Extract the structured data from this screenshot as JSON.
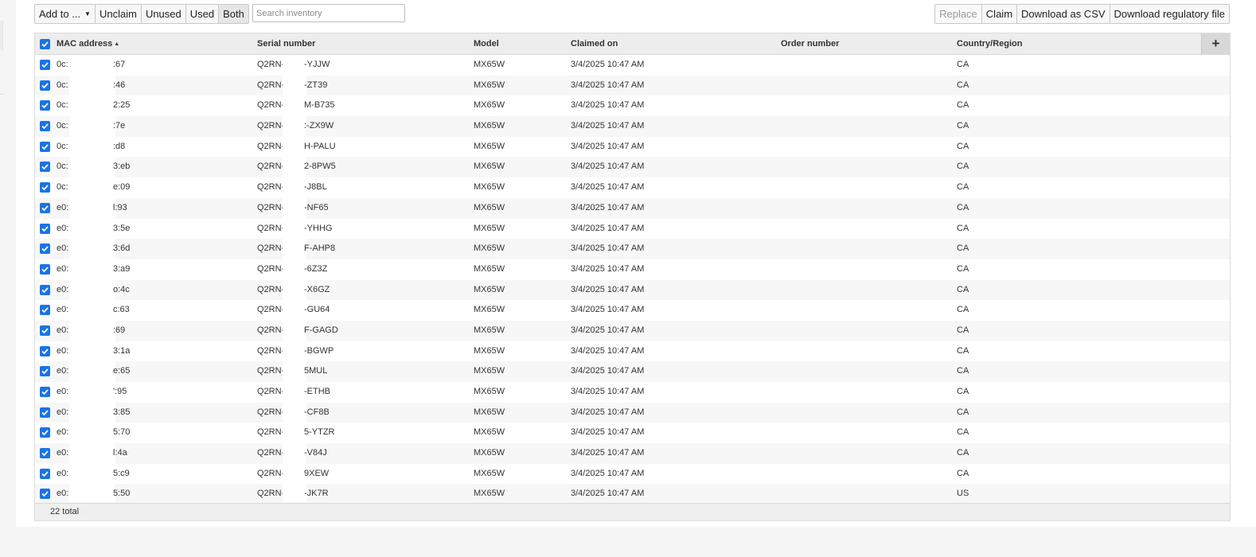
{
  "toolbar": {
    "add_to_label": "Add to ...",
    "filters": [
      "Unclaim",
      "Unused",
      "Used",
      "Both"
    ],
    "active_filter": "Both",
    "search_placeholder": "Search inventory",
    "replace_label": "Replace",
    "claim_label": "Claim",
    "download_csv_label": "Download as CSV",
    "download_regulatory_label": "Download regulatory file"
  },
  "table": {
    "columns": {
      "mac": "MAC address",
      "serial": "Serial number",
      "model": "Model",
      "claimed": "Claimed on",
      "order": "Order number",
      "country": "Country/Region"
    },
    "add_column_label": "+",
    "rows": [
      {
        "mac_prefix": "0c:",
        "mac_suffix": ":67",
        "serial_prefix": "Q2RN-",
        "serial_suffix": "-YJJW",
        "model": "MX65W",
        "claimed": "3/4/2025 10:47 AM",
        "order": "",
        "country": "CA"
      },
      {
        "mac_prefix": "0c:",
        "mac_suffix": ":46",
        "serial_prefix": "Q2RN-",
        "serial_suffix": "-ZT39",
        "model": "MX65W",
        "claimed": "3/4/2025 10:47 AM",
        "order": "",
        "country": "CA"
      },
      {
        "mac_prefix": "0c:",
        "mac_suffix": "2:25",
        "serial_prefix": "Q2RN-",
        "serial_suffix": "M-B735",
        "model": "MX65W",
        "claimed": "3/4/2025 10:47 AM",
        "order": "",
        "country": "CA"
      },
      {
        "mac_prefix": "0c:",
        "mac_suffix": ":7e",
        "serial_prefix": "Q2RN-",
        "serial_suffix": ":-ZX9W",
        "model": "MX65W",
        "claimed": "3/4/2025 10:47 AM",
        "order": "",
        "country": "CA"
      },
      {
        "mac_prefix": "0c:",
        "mac_suffix": ":d8",
        "serial_prefix": "Q2RN-",
        "serial_suffix": "H-PALU",
        "model": "MX65W",
        "claimed": "3/4/2025 10:47 AM",
        "order": "",
        "country": "CA"
      },
      {
        "mac_prefix": "0c:",
        "mac_suffix": "3:eb",
        "serial_prefix": "Q2RN-",
        "serial_suffix": "2-8PW5",
        "model": "MX65W",
        "claimed": "3/4/2025 10:47 AM",
        "order": "",
        "country": "CA"
      },
      {
        "mac_prefix": "0c:",
        "mac_suffix": "e:09",
        "serial_prefix": "Q2RN-",
        "serial_suffix": "-J8BL",
        "model": "MX65W",
        "claimed": "3/4/2025 10:47 AM",
        "order": "",
        "country": "CA"
      },
      {
        "mac_prefix": "e0:",
        "mac_suffix": "l:93",
        "serial_prefix": "Q2RN-",
        "serial_suffix": "-NF65",
        "model": "MX65W",
        "claimed": "3/4/2025 10:47 AM",
        "order": "",
        "country": "CA"
      },
      {
        "mac_prefix": "e0:",
        "mac_suffix": "3:5e",
        "serial_prefix": "Q2RN-",
        "serial_suffix": "-YHHG",
        "model": "MX65W",
        "claimed": "3/4/2025 10:47 AM",
        "order": "",
        "country": "CA"
      },
      {
        "mac_prefix": "e0:",
        "mac_suffix": "3:6d",
        "serial_prefix": "Q2RN-",
        "serial_suffix": "F-AHP8",
        "model": "MX65W",
        "claimed": "3/4/2025 10:47 AM",
        "order": "",
        "country": "CA"
      },
      {
        "mac_prefix": "e0:",
        "mac_suffix": "3:a9",
        "serial_prefix": "Q2RN-",
        "serial_suffix": "-6Z3Z",
        "model": "MX65W",
        "claimed": "3/4/2025 10:47 AM",
        "order": "",
        "country": "CA"
      },
      {
        "mac_prefix": "e0:",
        "mac_suffix": "o:4c",
        "serial_prefix": "Q2RN-",
        "serial_suffix": "-X6GZ",
        "model": "MX65W",
        "claimed": "3/4/2025 10:47 AM",
        "order": "",
        "country": "CA"
      },
      {
        "mac_prefix": "e0:",
        "mac_suffix": "c:63",
        "serial_prefix": "Q2RN-",
        "serial_suffix": "-GU64",
        "model": "MX65W",
        "claimed": "3/4/2025 10:47 AM",
        "order": "",
        "country": "CA"
      },
      {
        "mac_prefix": "e0:",
        "mac_suffix": ":69",
        "serial_prefix": "Q2RN-",
        "serial_suffix": "F-GAGD",
        "model": "MX65W",
        "claimed": "3/4/2025 10:47 AM",
        "order": "",
        "country": "CA"
      },
      {
        "mac_prefix": "e0:",
        "mac_suffix": "3:1a",
        "serial_prefix": "Q2RN-",
        "serial_suffix": "-BGWP",
        "model": "MX65W",
        "claimed": "3/4/2025 10:47 AM",
        "order": "",
        "country": "CA"
      },
      {
        "mac_prefix": "e0:",
        "mac_suffix": "e:65",
        "serial_prefix": "Q2RN-",
        "serial_suffix": "5MUL",
        "model": "MX65W",
        "claimed": "3/4/2025 10:47 AM",
        "order": "",
        "country": "CA"
      },
      {
        "mac_prefix": "e0:",
        "mac_suffix": "':95",
        "serial_prefix": "Q2RN-",
        "serial_suffix": "-ETHB",
        "model": "MX65W",
        "claimed": "3/4/2025 10:47 AM",
        "order": "",
        "country": "CA"
      },
      {
        "mac_prefix": "e0:",
        "mac_suffix": "3:85",
        "serial_prefix": "Q2RN-",
        "serial_suffix": "-CF8B",
        "model": "MX65W",
        "claimed": "3/4/2025 10:47 AM",
        "order": "",
        "country": "CA"
      },
      {
        "mac_prefix": "e0:",
        "mac_suffix": "5:70",
        "serial_prefix": "Q2RN-",
        "serial_suffix": "5-YTZR",
        "model": "MX65W",
        "claimed": "3/4/2025 10:47 AM",
        "order": "",
        "country": "CA"
      },
      {
        "mac_prefix": "e0:",
        "mac_suffix": "l:4a",
        "serial_prefix": "Q2RN-",
        "serial_suffix": "-V84J",
        "model": "MX65W",
        "claimed": "3/4/2025 10:47 AM",
        "order": "",
        "country": "CA"
      },
      {
        "mac_prefix": "e0:",
        "mac_suffix": "5:c9",
        "serial_prefix": "Q2RN-",
        "serial_suffix": "9XEW",
        "model": "MX65W",
        "claimed": "3/4/2025 10:47 AM",
        "order": "",
        "country": "CA"
      },
      {
        "mac_prefix": "e0:",
        "mac_suffix": "5:50",
        "serial_prefix": "Q2RN-",
        "serial_suffix": "-JK7R",
        "model": "MX65W",
        "claimed": "3/4/2025 10:47 AM",
        "order": "",
        "country": "US"
      }
    ],
    "footer_total": "22 total"
  },
  "colors": {
    "accent": "#1a73e8",
    "header_bg": "#ededed",
    "row_alt_bg": "#f7f7f7"
  }
}
